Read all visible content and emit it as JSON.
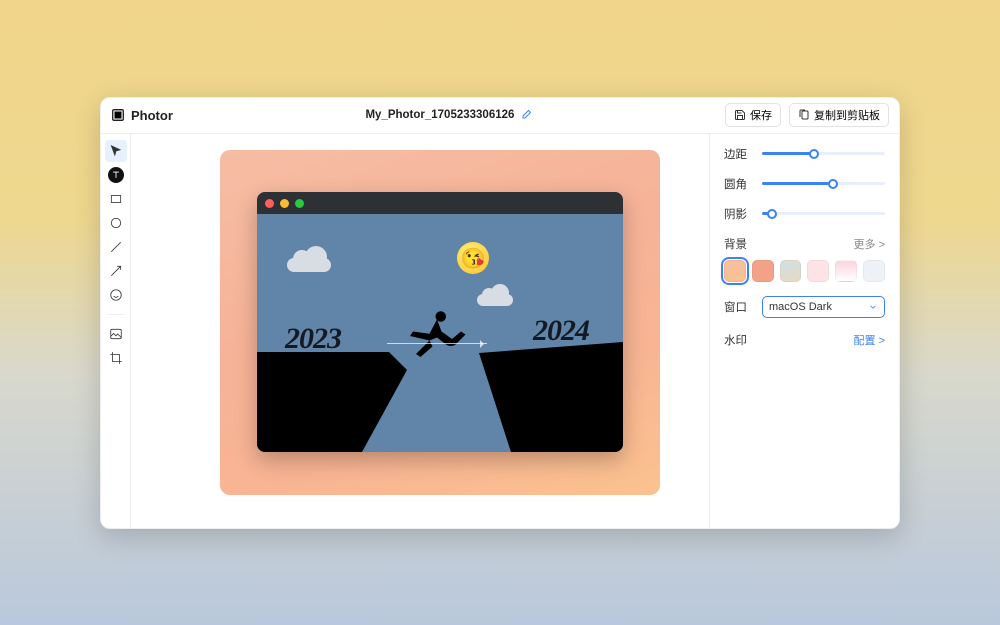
{
  "app_name": "Photor",
  "document_name": "My_Photor_1705233306126",
  "toolbar_top": {
    "save_label": "保存",
    "copy_label": "复制到剪贴板"
  },
  "tools": [
    "cursor",
    "text",
    "rect",
    "circle",
    "line",
    "arrow",
    "emoji",
    "image",
    "crop"
  ],
  "canvas": {
    "year_from": "2023",
    "year_to": "2024",
    "emoji": "😘"
  },
  "sidebar": {
    "padding": {
      "label": "边距",
      "value": 42
    },
    "radius": {
      "label": "圆角",
      "value": 58
    },
    "shadow": {
      "label": "阴影",
      "value": 8
    },
    "background": {
      "label": "背景",
      "more": "更多 >",
      "swatches": [
        "linear-gradient(160deg,#f6bda4,#fbc28e)",
        "#f3a288",
        "linear-gradient(160deg,#cfe0e5,#e8d9c2)",
        "#fde3e6",
        "linear-gradient(#fbd5dc,#fff)",
        "#eef2f7"
      ],
      "selected": 0
    },
    "window": {
      "label": "窗口",
      "value": "macOS Dark"
    },
    "watermark": {
      "label": "水印",
      "action": "配置 >"
    }
  }
}
